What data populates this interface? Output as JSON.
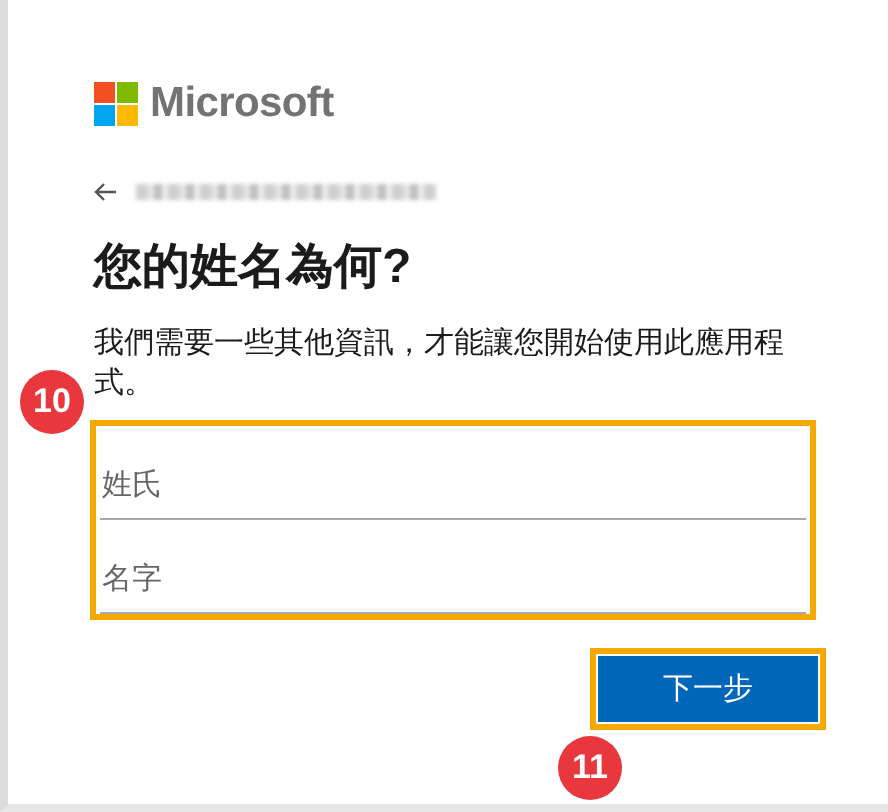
{
  "brand": "Microsoft",
  "title": "您的姓名為何?",
  "description": "我們需要一些其他資訊，才能讓您開始使用此應用程式。",
  "fields": [
    {
      "placeholder": "姓氏"
    },
    {
      "placeholder": "名字"
    }
  ],
  "next_button": "下一步",
  "callouts": [
    "10",
    "11"
  ]
}
